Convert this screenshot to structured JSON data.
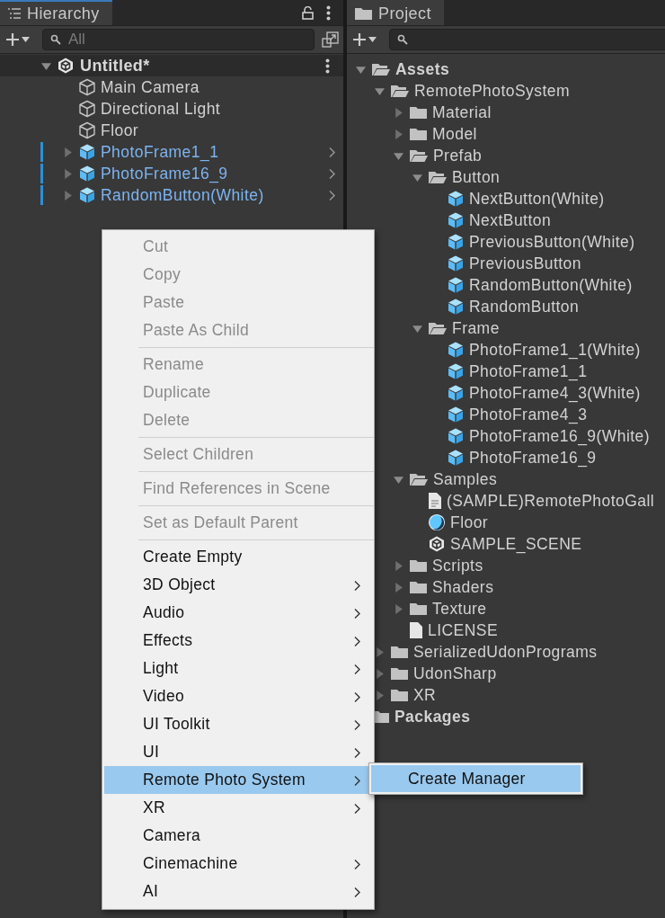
{
  "hierarchy": {
    "tab": {
      "title": "Hierarchy"
    },
    "search": {
      "placeholder": "All"
    },
    "scene": {
      "name": "Untitled*",
      "expanded": true
    },
    "items": [
      {
        "name": "Main Camera",
        "kind": "object",
        "modified": false
      },
      {
        "name": "Directional Light",
        "kind": "object",
        "modified": false
      },
      {
        "name": "Floor",
        "kind": "object",
        "modified": false
      },
      {
        "name": "PhotoFrame1_1",
        "kind": "prefab",
        "expanded": false,
        "modified": true
      },
      {
        "name": "PhotoFrame16_9",
        "kind": "prefab",
        "expanded": false,
        "modified": true
      },
      {
        "name": "RandomButton(White)",
        "kind": "prefab",
        "expanded": false,
        "modified": true
      }
    ]
  },
  "project": {
    "tab": {
      "title": "Project"
    },
    "tree": [
      {
        "name": "Assets",
        "kind": "folder",
        "expanded": true,
        "children": [
          {
            "name": "RemotePhotoSystem",
            "kind": "folder",
            "expanded": true,
            "children": [
              {
                "name": "Material",
                "kind": "folder",
                "expanded": false
              },
              {
                "name": "Model",
                "kind": "folder",
                "expanded": false
              },
              {
                "name": "Prefab",
                "kind": "folder",
                "expanded": true,
                "children": [
                  {
                    "name": "Button",
                    "kind": "folder",
                    "expanded": true,
                    "children": [
                      {
                        "name": "NextButton(White)",
                        "kind": "prefab"
                      },
                      {
                        "name": "NextButton",
                        "kind": "prefab"
                      },
                      {
                        "name": "PreviousButton(White)",
                        "kind": "prefab"
                      },
                      {
                        "name": "PreviousButton",
                        "kind": "prefab"
                      },
                      {
                        "name": "RandomButton(White)",
                        "kind": "prefab"
                      },
                      {
                        "name": "RandomButton",
                        "kind": "prefab"
                      }
                    ]
                  },
                  {
                    "name": "Frame",
                    "kind": "folder",
                    "expanded": true,
                    "children": [
                      {
                        "name": "PhotoFrame1_1(White)",
                        "kind": "prefab"
                      },
                      {
                        "name": "PhotoFrame1_1",
                        "kind": "prefab"
                      },
                      {
                        "name": "PhotoFrame4_3(White)",
                        "kind": "prefab"
                      },
                      {
                        "name": "PhotoFrame4_3",
                        "kind": "prefab"
                      },
                      {
                        "name": "PhotoFrame16_9(White)",
                        "kind": "prefab"
                      },
                      {
                        "name": "PhotoFrame16_9",
                        "kind": "prefab"
                      }
                    ]
                  }
                ]
              },
              {
                "name": "Samples",
                "kind": "folder",
                "expanded": true,
                "children": [
                  {
                    "name": "(SAMPLE)RemotePhotoGall",
                    "kind": "text"
                  },
                  {
                    "name": "Floor",
                    "kind": "material"
                  },
                  {
                    "name": "SAMPLE_SCENE",
                    "kind": "scene"
                  }
                ]
              },
              {
                "name": "Scripts",
                "kind": "folder",
                "expanded": false
              },
              {
                "name": "Shaders",
                "kind": "folder",
                "expanded": false
              },
              {
                "name": "Texture",
                "kind": "folder",
                "expanded": false
              },
              {
                "name": "LICENSE",
                "kind": "file"
              }
            ]
          },
          {
            "name": "SerializedUdonPrograms",
            "kind": "folder",
            "expanded": false
          },
          {
            "name": "UdonSharp",
            "kind": "folder",
            "expanded": false
          },
          {
            "name": "XR",
            "kind": "folder",
            "expanded": false
          }
        ]
      },
      {
        "name": "Packages",
        "kind": "folder"
      }
    ]
  },
  "context_menu": {
    "groups": [
      [
        {
          "label": "Cut",
          "disabled": true,
          "submenu": false,
          "selected": false
        },
        {
          "label": "Copy",
          "disabled": true,
          "submenu": false,
          "selected": false
        },
        {
          "label": "Paste",
          "disabled": true,
          "submenu": false,
          "selected": false
        },
        {
          "label": "Paste As Child",
          "disabled": true,
          "submenu": false,
          "selected": false
        }
      ],
      [
        {
          "label": "Rename",
          "disabled": true,
          "submenu": false,
          "selected": false
        },
        {
          "label": "Duplicate",
          "disabled": true,
          "submenu": false,
          "selected": false
        },
        {
          "label": "Delete",
          "disabled": true,
          "submenu": false,
          "selected": false
        }
      ],
      [
        {
          "label": "Select Children",
          "disabled": true,
          "submenu": false,
          "selected": false
        }
      ],
      [
        {
          "label": "Find References in Scene",
          "disabled": true,
          "submenu": false,
          "selected": false
        }
      ],
      [
        {
          "label": "Set as Default Parent",
          "disabled": true,
          "submenu": false,
          "selected": false
        }
      ],
      [
        {
          "label": "Create Empty",
          "disabled": false,
          "submenu": false,
          "selected": false
        },
        {
          "label": "3D Object",
          "disabled": false,
          "submenu": true,
          "selected": false
        },
        {
          "label": "Audio",
          "disabled": false,
          "submenu": true,
          "selected": false
        },
        {
          "label": "Effects",
          "disabled": false,
          "submenu": true,
          "selected": false
        },
        {
          "label": "Light",
          "disabled": false,
          "submenu": true,
          "selected": false
        },
        {
          "label": "Video",
          "disabled": false,
          "submenu": true,
          "selected": false
        },
        {
          "label": "UI Toolkit",
          "disabled": false,
          "submenu": true,
          "selected": false
        },
        {
          "label": "UI",
          "disabled": false,
          "submenu": true,
          "selected": false
        },
        {
          "label": "Remote Photo System",
          "disabled": false,
          "submenu": true,
          "selected": true
        },
        {
          "label": "XR",
          "disabled": false,
          "submenu": true,
          "selected": false
        },
        {
          "label": "Camera",
          "disabled": false,
          "submenu": false,
          "selected": false
        },
        {
          "label": "Cinemachine",
          "disabled": false,
          "submenu": true,
          "selected": false
        },
        {
          "label": "AI",
          "disabled": false,
          "submenu": true,
          "selected": false
        }
      ]
    ],
    "submenu": [
      {
        "label": "Create Manager",
        "selected": true
      }
    ]
  }
}
